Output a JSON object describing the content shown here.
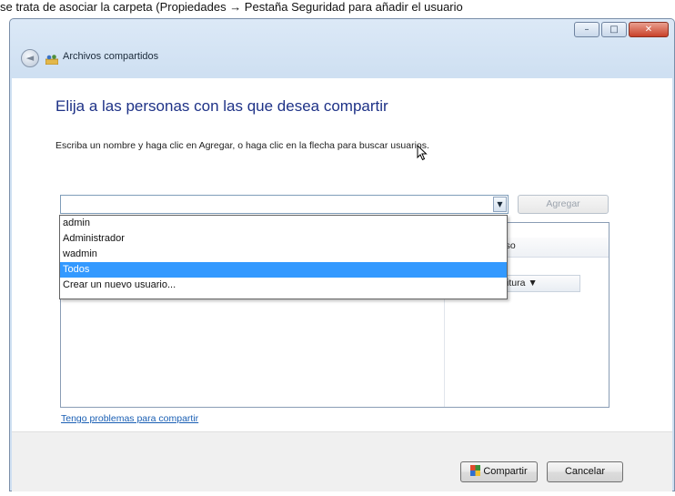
{
  "page_header": {
    "text": "se trata de asociar la carpeta (Propiedades → Pestaña Seguridad para añadir el usuario"
  },
  "window": {
    "controls": {
      "minimize": "–",
      "maximize": "□",
      "close": "✕"
    },
    "back_arrow": "◄",
    "wizard_title": "Archivos compartidos"
  },
  "main": {
    "heading": "Elija a las personas con las que desea compartir",
    "instructions": "Escriba un nombre y haga clic en Agregar, o haga clic en la flecha para buscar usuarios.",
    "combo": {
      "value": "",
      "arrow": "▼"
    },
    "add_button": "Agregar",
    "permission_header": "rmiso",
    "permission_value": "scritura ▼",
    "dropdown_items": [
      "admin",
      "Administrador",
      "wadmin",
      "Todos",
      "Crear un nuevo usuario..."
    ],
    "selected_item": "Todos",
    "help_link": "Tengo problemas para compartir"
  },
  "footer": {
    "share_button": "Compartir",
    "cancel_button": "Cancelar"
  },
  "colors": {
    "accent": "#3399ff",
    "heading": "#1e3287",
    "link": "#1a5fb4",
    "chrome": "#cfe0f2"
  }
}
